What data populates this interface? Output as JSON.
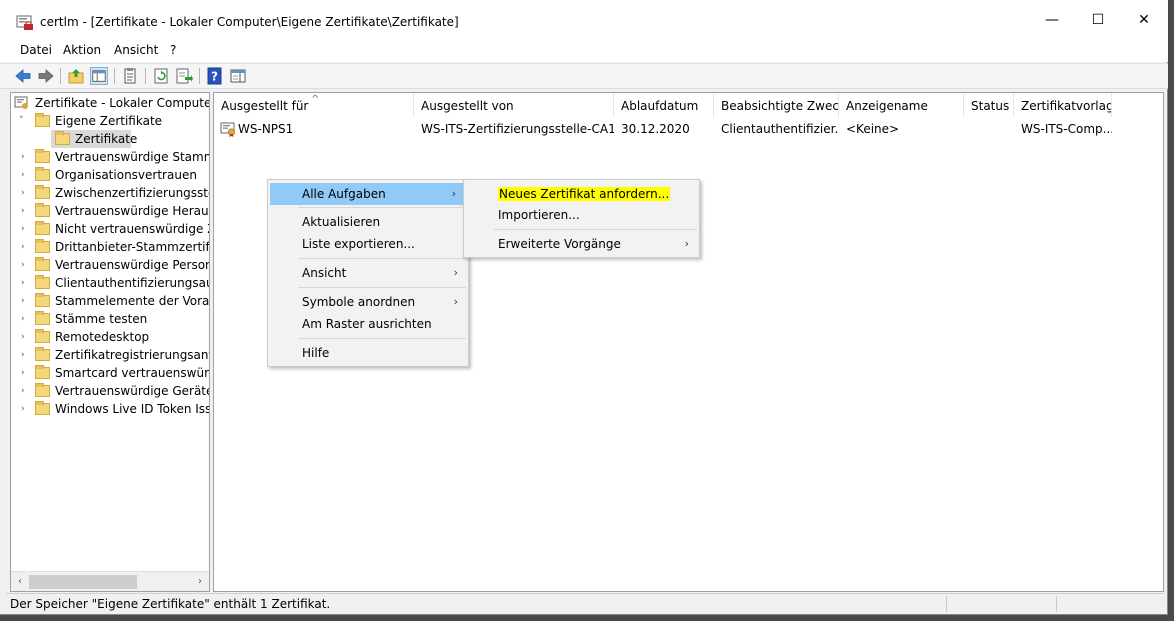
{
  "window": {
    "title": "certlm - [Zertifikate - Lokaler Computer\\Eigene Zertifikate\\Zertifikate]",
    "minimize": "—",
    "maximize": "☐",
    "close": "✕"
  },
  "menu": {
    "items": [
      "Datei",
      "Aktion",
      "Ansicht",
      "?"
    ]
  },
  "tree": {
    "root": "Zertifikate - Lokaler Computer",
    "items": [
      {
        "label": "Eigene Zertifikate",
        "expanded": true
      },
      {
        "label": "Zertifikate",
        "selected": true
      },
      {
        "label": "Vertrauenswürdige Stammzer"
      },
      {
        "label": "Organisationsvertrauen"
      },
      {
        "label": "Zwischenzertifizierungssteller"
      },
      {
        "label": "Vertrauenswürdige Herausgel"
      },
      {
        "label": "Nicht vertrauenswürdige Zert"
      },
      {
        "label": "Drittanbieter-Stammzertifizie"
      },
      {
        "label": "Vertrauenswürdige Personen"
      },
      {
        "label": "Clientauthentifizierungsausst"
      },
      {
        "label": "Stammelemente der Vorabve"
      },
      {
        "label": "Stämme testen"
      },
      {
        "label": "Remotedesktop"
      },
      {
        "label": "Zertifikatregistrierungsanford"
      },
      {
        "label": "Smartcard vertrauenswürdige"
      },
      {
        "label": "Vertrauenswürdige Geräte"
      },
      {
        "label": "Windows Live ID Token Issuer"
      }
    ]
  },
  "list": {
    "columns": [
      "Ausgestellt für",
      "Ausgestellt von",
      "Ablaufdatum",
      "Beabsichtigte Zwec...",
      "Anzeigename",
      "Status",
      "Zertifikatvorlage"
    ],
    "rows": [
      [
        "WS-NPS1",
        "WS-ITS-Zertifizierungsstelle-CA1",
        "30.12.2020",
        "Clientauthentifizier...",
        "<Keine>",
        "",
        "WS-ITS-Comp..."
      ]
    ]
  },
  "context_menu": {
    "items": [
      {
        "label": "Alle Aufgaben",
        "submenu": true,
        "highlighted": true
      },
      {
        "label": "Aktualisieren"
      },
      {
        "label": "Liste exportieren..."
      },
      {
        "label": "Ansicht",
        "submenu": true
      },
      {
        "label": "Symbole anordnen",
        "submenu": true
      },
      {
        "label": "Am Raster ausrichten"
      },
      {
        "label": "Hilfe"
      }
    ],
    "submenu_arrow": "›"
  },
  "submenu": {
    "items": [
      {
        "label": "Neues Zertifikat anfordern...",
        "marked": true
      },
      {
        "label": "Importieren..."
      },
      {
        "label": "Erweiterte Vorgänge",
        "submenu": true
      }
    ]
  },
  "status": {
    "text": "Der Speicher \"Eigene Zertifikate\" enthält 1 Zertifikat."
  },
  "colors": {
    "highlight": "#91c9f7",
    "marker": "#ffff00"
  }
}
